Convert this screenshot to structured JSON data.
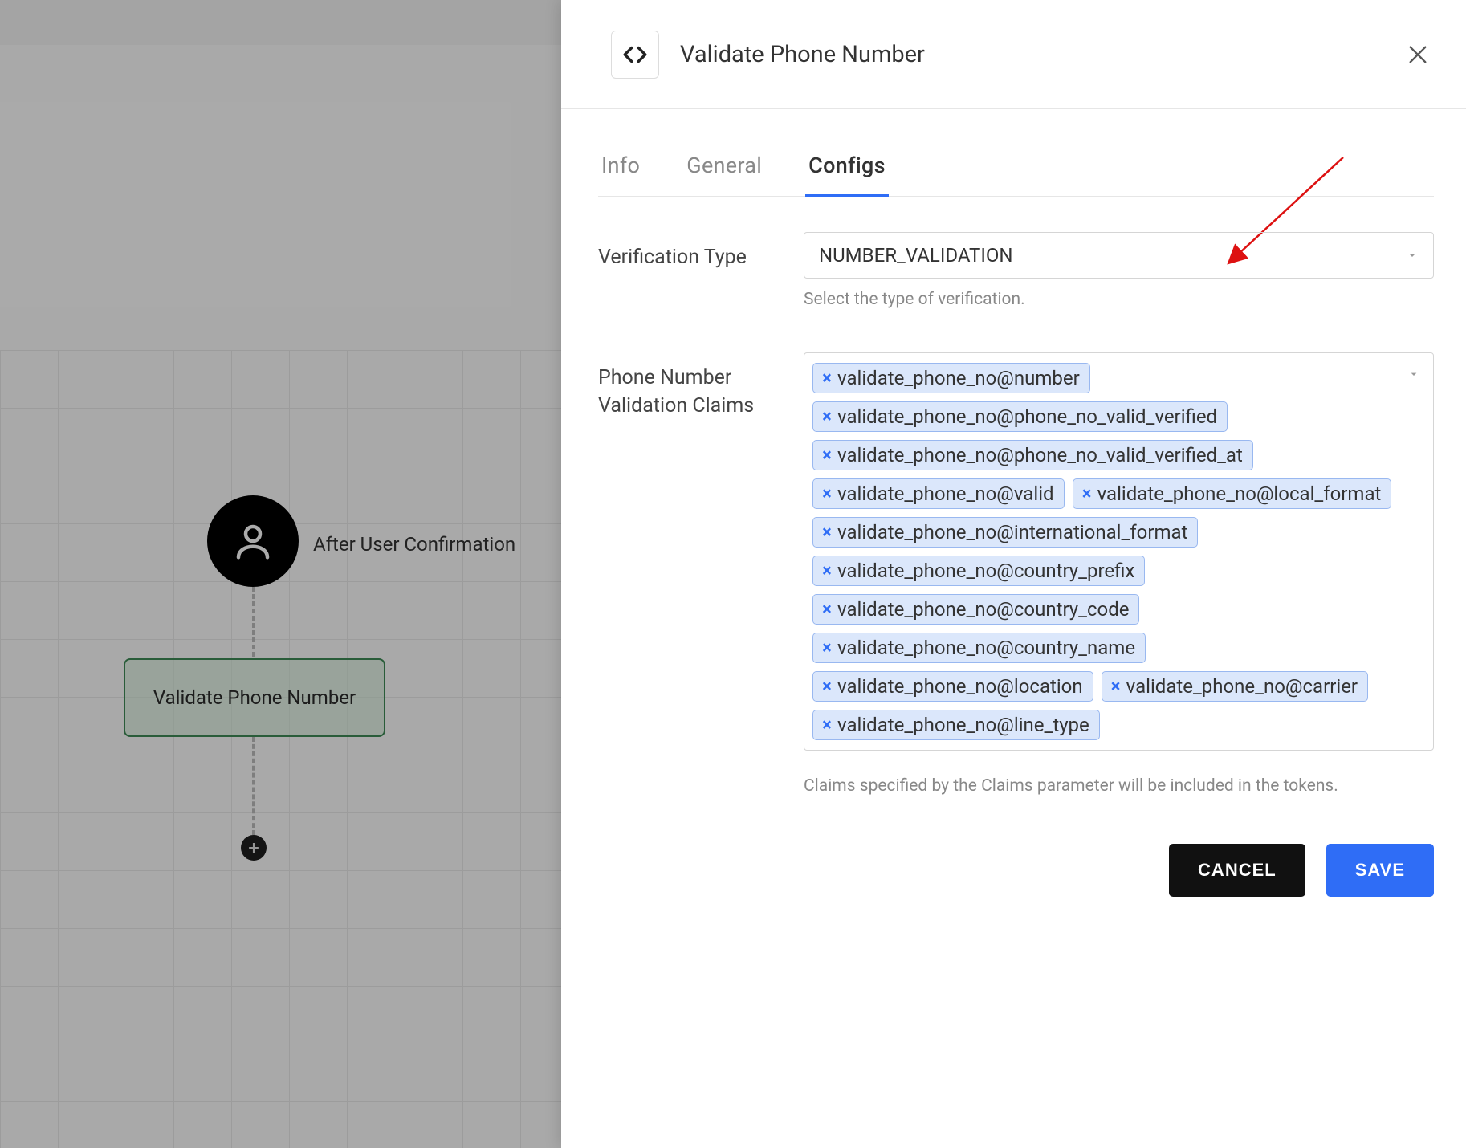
{
  "canvas": {
    "root_label": "After User Confirmation",
    "action_node_label": "Validate Phone Number"
  },
  "panel": {
    "title": "Validate Phone Number",
    "tabs": {
      "info": "Info",
      "general": "General",
      "configs": "Configs"
    },
    "active_tab": "configs",
    "verification_type": {
      "label": "Verification Type",
      "value": "NUMBER_VALIDATION",
      "helper": "Select the type of verification."
    },
    "claims": {
      "label": "Phone Number Validation Claims",
      "helper": "Claims specified by the Claims parameter will be included in the tokens.",
      "items": [
        "validate_phone_no@number",
        "validate_phone_no@phone_no_valid_verified",
        "validate_phone_no@phone_no_valid_verified_at",
        "validate_phone_no@valid",
        "validate_phone_no@local_format",
        "validate_phone_no@international_format",
        "validate_phone_no@country_prefix",
        "validate_phone_no@country_code",
        "validate_phone_no@country_name",
        "validate_phone_no@location",
        "validate_phone_no@carrier",
        "validate_phone_no@line_type"
      ]
    },
    "buttons": {
      "cancel": "CANCEL",
      "save": "SAVE"
    }
  }
}
